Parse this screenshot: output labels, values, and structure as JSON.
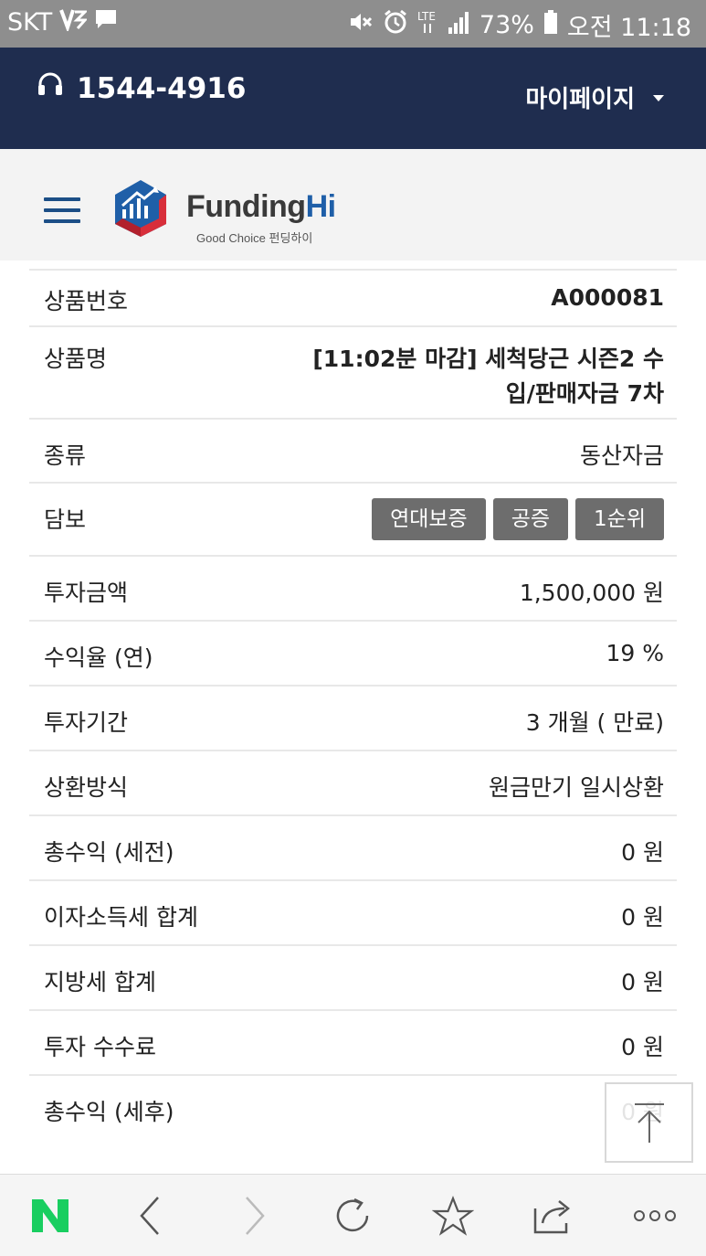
{
  "status_bar": {
    "carrier": "SKT",
    "battery": "73%",
    "time": "오전 11:18"
  },
  "header": {
    "phone": "1544-4916",
    "mypage": "마이페이지"
  },
  "logo": {
    "name_prefix": "Funding",
    "name_suffix": "Hi",
    "tagline": "Good Choice 펀딩하이"
  },
  "details": {
    "product_no": {
      "label": "상품번호",
      "value": "A000081"
    },
    "product_name": {
      "label": "상품명",
      "value_line1": "[11:02분 마감] 세척당근 시즌2 수",
      "value_line2": "입/판매자금 7차"
    },
    "type": {
      "label": "종류",
      "value": "동산자금"
    },
    "collateral": {
      "label": "담보",
      "tags": [
        "연대보증",
        "공증",
        "1순위"
      ]
    },
    "investment_amount": {
      "label": "투자금액",
      "value": "1,500,000 원"
    },
    "yield": {
      "label": "수익율 (연)",
      "value": "19 %"
    },
    "period": {
      "label": "투자기간",
      "value": "3 개월 ( 만료)"
    },
    "repayment": {
      "label": "상환방식",
      "value": "원금만기 일시상환"
    },
    "total_profit_pre_tax": {
      "label": "총수익 (세전)",
      "value": "0 원"
    },
    "interest_tax": {
      "label": "이자소득세 합계",
      "value": "0 원"
    },
    "local_tax": {
      "label": "지방세 합계",
      "value": "0 원"
    },
    "fee": {
      "label": "투자 수수료",
      "value": "0 원"
    },
    "total_profit_post_tax": {
      "label": "총수익 (세후)",
      "value": "0 원"
    }
  },
  "icons": {
    "naver": "N"
  },
  "colors": {
    "header_bg": "#1f2d4f",
    "brand_blue": "#1f5fa8",
    "tag_bg": "#6d6d6d",
    "naver_green": "#19ce60"
  }
}
